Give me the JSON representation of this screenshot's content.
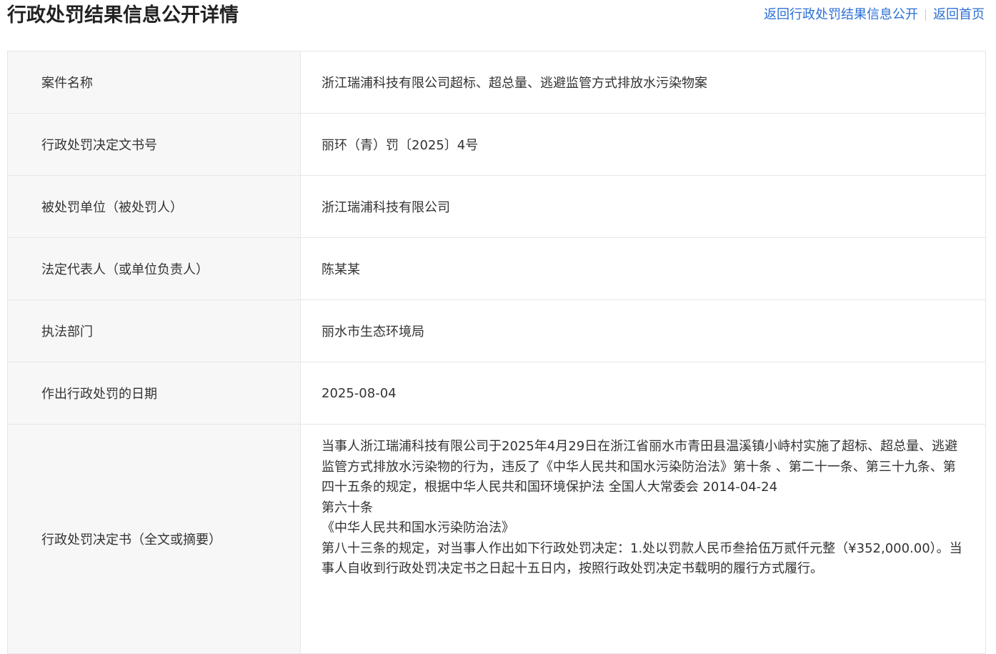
{
  "header": {
    "title": "行政处罚结果信息公开详情",
    "link_back_list": "返回行政处罚结果信息公开",
    "link_home": "返回首页"
  },
  "rows": [
    {
      "label": "案件名称",
      "value": "浙江瑞浦科技有限公司超标、超总量、逃避监管方式排放水污染物案"
    },
    {
      "label": "行政处罚决定文书号",
      "value": "丽环（青）罚〔2025〕4号"
    },
    {
      "label": "被处罚单位（被处罚人）",
      "value": "浙江瑞浦科技有限公司"
    },
    {
      "label": "法定代表人（或单位负责人）",
      "value": "陈某某"
    },
    {
      "label": "执法部门",
      "value": "丽水市生态环境局"
    },
    {
      "label": "作出行政处罚的日期",
      "value": "2025-08-04"
    }
  ],
  "decision": {
    "label": "行政处罚决定书（全文或摘要）",
    "paragraphs": [
      "当事人浙江瑞浦科技有限公司于2025年4月29日在浙江省丽水市青田县温溪镇小峙村实施了超标、超总量、逃避监管方式排放水污染物的行为，违反了《中华人民共和国水污染防治法》第十条 、第二十一条、第三十九条、第四十五条的规定，根据中华人民共和国环境保护法 全国人大常委会 2014-04-24",
      "第六十条",
      "《中华人民共和国水污染防治法》",
      "第八十三条的规定，对当事人作出如下行政处罚决定：1.处以罚款人民币叁拾伍万贰仟元整（¥352,000.00）。当事人自收到行政处罚决定书之日起十五日内，按照行政处罚决定书载明的履行方式履行。"
    ]
  }
}
